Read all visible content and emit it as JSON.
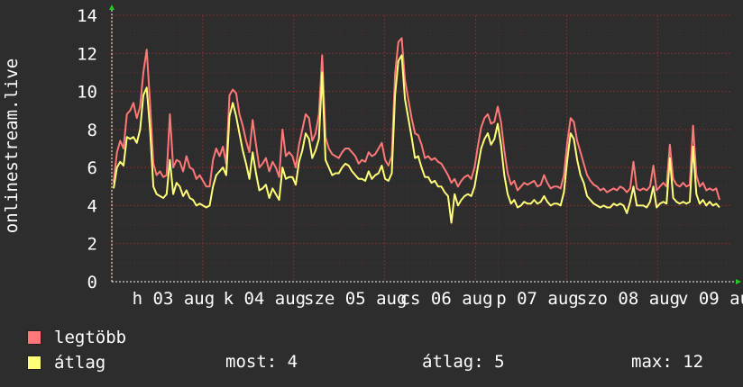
{
  "chart_data": {
    "type": "line",
    "ylabel": "onlinestream.live",
    "ylim": [
      0,
      14
    ],
    "yticks": [
      0,
      2,
      4,
      6,
      8,
      10,
      12,
      14
    ],
    "x_tick_labels": [
      "h 03 aug",
      "k 04 aug",
      "sze 05 aug",
      "cs 06 aug",
      "p 07 aug",
      "szo 08 aug",
      "v 09 aug"
    ],
    "grid": true,
    "series": [
      {
        "name": "legtöbb",
        "color": "#ff7777",
        "values": [
          5.2,
          6.8,
          7.4,
          7.0,
          8.8,
          9.0,
          9.4,
          8.6,
          9.2,
          11.0,
          12.2,
          9.4,
          6.2,
          5.6,
          5.8,
          5.5,
          5.6,
          8.8,
          6.0,
          6.4,
          6.3,
          5.8,
          6.6,
          6.0,
          5.9,
          5.4,
          5.6,
          5.3,
          5.0,
          5.0,
          6.4,
          7.0,
          6.6,
          7.1,
          6.2,
          9.8,
          10.1,
          9.9,
          8.8,
          8.2,
          7.4,
          6.8,
          8.5,
          7.2,
          6.0,
          6.2,
          6.5,
          5.8,
          6.3,
          6.0,
          5.5,
          8.0,
          6.6,
          6.8,
          6.6,
          6.0,
          7.2,
          8.0,
          8.8,
          8.6,
          7.4,
          7.8,
          8.8,
          11.9,
          7.6,
          7.0,
          6.7,
          6.6,
          6.5,
          6.8,
          7.0,
          7.0,
          6.8,
          6.6,
          6.2,
          6.4,
          6.3,
          6.8,
          6.6,
          6.7,
          7.0,
          7.3,
          6.4,
          6.1,
          6.6,
          10.9,
          12.6,
          12.8,
          10.6,
          9.6,
          8.6,
          7.8,
          7.7,
          7.2,
          6.5,
          6.6,
          6.4,
          6.5,
          6.3,
          6.2,
          5.9,
          5.6,
          5.2,
          5.4,
          5.0,
          5.3,
          5.5,
          5.6,
          5.4,
          6.0,
          7.1,
          8.1,
          8.6,
          8.8,
          8.3,
          8.4,
          9.2,
          8.4,
          6.9,
          5.7,
          5.1,
          5.3,
          4.8,
          5.0,
          5.2,
          5.1,
          5.2,
          5.3,
          5.0,
          5.1,
          5.6,
          5.2,
          4.9,
          5.0,
          5.0,
          4.9,
          5.6,
          7.3,
          8.6,
          8.4,
          7.4,
          6.8,
          6.2,
          5.6,
          5.3,
          5.1,
          5.0,
          4.8,
          4.9,
          4.7,
          4.8,
          4.9,
          4.8,
          5.0,
          4.9,
          4.7,
          4.9,
          6.3,
          4.9,
          4.8,
          4.9,
          4.8,
          5.0,
          6.1,
          4.8,
          5.0,
          5.2,
          5.0,
          7.2,
          5.4,
          5.1,
          5.0,
          5.2,
          5.0,
          5.1,
          8.2,
          5.6,
          5.0,
          5.2,
          4.8,
          4.9,
          4.8,
          4.9,
          4.3
        ]
      },
      {
        "name": "átlag",
        "color": "#ffff77",
        "values": [
          4.9,
          6.0,
          6.3,
          6.1,
          7.6,
          7.5,
          7.6,
          7.3,
          8.0,
          9.8,
          10.2,
          8.0,
          5.0,
          4.6,
          4.5,
          4.4,
          4.6,
          6.4,
          4.6,
          5.2,
          5.0,
          4.5,
          4.8,
          4.4,
          4.3,
          4.0,
          4.1,
          4.0,
          3.9,
          4.0,
          5.0,
          5.6,
          5.8,
          6.0,
          5.6,
          8.7,
          9.4,
          8.7,
          7.8,
          6.9,
          6.2,
          5.4,
          6.8,
          5.7,
          4.8,
          4.9,
          5.1,
          4.4,
          4.9,
          4.6,
          4.3,
          6.0,
          5.4,
          5.5,
          5.5,
          5.1,
          6.3,
          6.9,
          7.8,
          7.5,
          6.5,
          6.9,
          7.5,
          11.0,
          6.4,
          6.0,
          5.6,
          5.7,
          5.7,
          6.0,
          6.2,
          6.1,
          5.8,
          5.6,
          5.4,
          5.4,
          5.3,
          5.8,
          5.4,
          5.6,
          5.7,
          6.1,
          5.4,
          5.3,
          5.7,
          9.8,
          11.6,
          11.9,
          9.6,
          8.6,
          7.6,
          6.5,
          6.6,
          6.0,
          5.5,
          5.5,
          5.2,
          5.3,
          5.0,
          5.0,
          4.7,
          4.5,
          3.1,
          4.6,
          4.0,
          4.3,
          4.5,
          4.6,
          4.5,
          5.0,
          6.0,
          7.0,
          7.5,
          7.8,
          7.2,
          7.5,
          8.3,
          7.2,
          5.6,
          4.6,
          4.1,
          4.3,
          3.9,
          4.0,
          4.2,
          4.1,
          4.1,
          4.3,
          4.1,
          4.2,
          4.5,
          4.2,
          4.0,
          4.1,
          4.1,
          4.0,
          4.7,
          6.4,
          7.8,
          7.5,
          6.4,
          5.6,
          5.2,
          4.5,
          4.3,
          4.1,
          4.0,
          3.9,
          4.0,
          3.9,
          3.9,
          4.1,
          4.0,
          4.1,
          4.0,
          3.6,
          4.2,
          5.0,
          4.0,
          4.0,
          4.0,
          3.9,
          4.2,
          5.0,
          3.9,
          4.1,
          4.2,
          4.1,
          6.5,
          4.4,
          4.2,
          4.1,
          4.2,
          4.1,
          4.2,
          7.1,
          4.6,
          4.1,
          4.3,
          4.0,
          4.2,
          4.0,
          4.1,
          3.9
        ]
      }
    ]
  },
  "legend": [
    {
      "label": "legtöbb",
      "color": "#ff7777"
    },
    {
      "label": "átlag",
      "color": "#ffff77"
    }
  ],
  "stats": {
    "now_label": "most: 4",
    "avg_label": "átlag: 5",
    "max_label": "max: 12"
  }
}
